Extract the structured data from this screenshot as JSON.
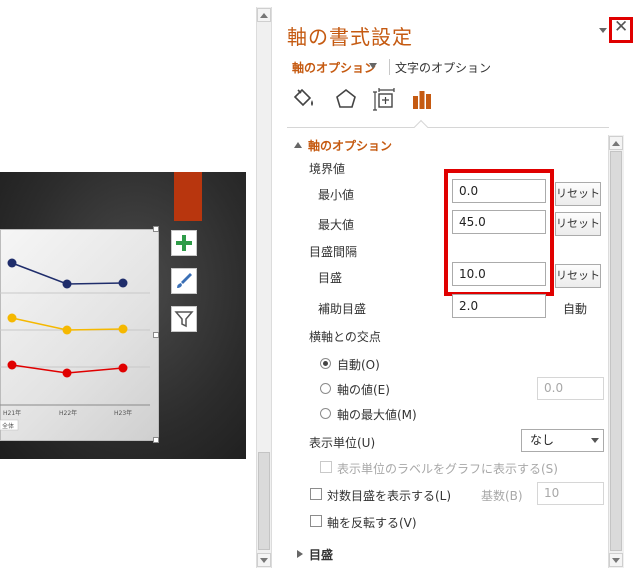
{
  "pane": {
    "title": "軸の書式設定",
    "close_glyph": "✕",
    "tabs": {
      "axis_options": "軸のオプション",
      "text_options": "文字のオプション"
    },
    "icons": [
      "fill-line-icon",
      "effects-icon",
      "size-properties-icon",
      "axis-options-icon"
    ],
    "section": {
      "title": "軸のオプション",
      "bounds_label": "境界値",
      "min_label": "最小値",
      "min_value": "0.0",
      "max_label": "最大値",
      "max_value": "45.0",
      "reset_label": "リセット",
      "units_label": "目盛間隔",
      "major_label": "目盛",
      "major_value": "10.0",
      "minor_label": "補助目盛",
      "minor_value": "2.0",
      "auto_label": "自動",
      "cross_label": "横軸との交点",
      "radio_auto": "自動(O)",
      "radio_value": "軸の値(E)",
      "radio_value_field": "0.0",
      "radio_max": "軸の最大値(M)",
      "display_units_label": "表示単位(U)",
      "display_units_value": "なし",
      "show_units_label": "表示単位のラベルをグラフに表示する(S)",
      "log_label": "対数目盛を表示する(L)",
      "base_label": "基数(B)",
      "base_value": "10",
      "reverse_label": "軸を反転する(V)"
    },
    "section2_title": "目盛"
  },
  "chart": {
    "x_labels": [
      "H21年",
      "H22年",
      "H23年"
    ],
    "legend_text": "全体",
    "colors": {
      "navy": "#1f2d6b",
      "yellow": "#f5b800",
      "red": "#e00000"
    }
  },
  "colors": {
    "accent": "#c55a11",
    "highlight": "#e00000"
  }
}
